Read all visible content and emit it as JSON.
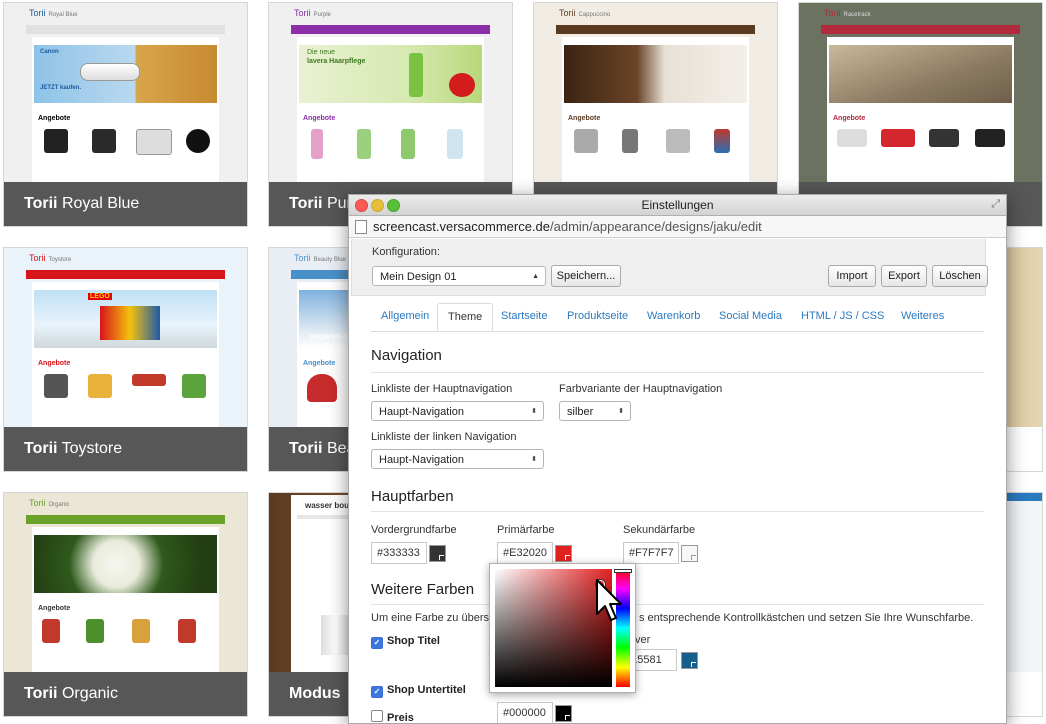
{
  "themes": [
    {
      "brand": "Torii",
      "name": "Royal Blue"
    },
    {
      "brand": "Torii",
      "name": "Purple"
    },
    {
      "brand": "Torii",
      "name": "Cappuccino"
    },
    {
      "brand": "Torii",
      "name": "Racetrack"
    },
    {
      "brand": "Torii",
      "name": "Toystore"
    },
    {
      "brand": "Torii",
      "name": "Beauty Blue"
    },
    {
      "brand": "Torii",
      "name": "Organic"
    },
    {
      "brand": "",
      "name": "Modus"
    }
  ],
  "thumbnails": {
    "offers_heading": "Angebote",
    "royal_banner_brand": "Canon",
    "royal_banner_cta": "JETZT kaufen.",
    "purple_banner_line1": "Die neue",
    "purple_banner_line2": "lavera Haarpflege",
    "lego_logo": "LEGO",
    "snow_banner": "SNOWWEAR",
    "modus_header": "wasser boutique"
  },
  "window": {
    "title": "Einstellungen",
    "url_domain": "screencast.versacommerce.de",
    "url_path": "/admin/appearance/designs/jaku/edit"
  },
  "config": {
    "label": "Konfiguration:",
    "selected_design": "Mein Design 01",
    "save": "Speichern...",
    "import": "Import",
    "export": "Export",
    "delete": "Löschen"
  },
  "tabs": [
    {
      "label": "Allgemein",
      "active": false
    },
    {
      "label": "Theme",
      "active": true
    },
    {
      "label": "Startseite",
      "active": false
    },
    {
      "label": "Produktseite",
      "active": false
    },
    {
      "label": "Warenkorb",
      "active": false
    },
    {
      "label": "Social Media",
      "active": false
    },
    {
      "label": "HTML / JS / CSS",
      "active": false
    },
    {
      "label": "Weiteres",
      "active": false
    }
  ],
  "navigation": {
    "heading": "Navigation",
    "main_nav_label": "Linkliste der Hauptnavigation",
    "main_nav_value": "Haupt-Navigation",
    "color_variant_label": "Farbvariante der Hauptnavigation",
    "color_variant_value": "silber",
    "left_nav_label": "Linkliste der linken Navigation",
    "left_nav_value": "Haupt-Navigation"
  },
  "main_colors": {
    "heading": "Hauptfarben",
    "foreground_label": "Vordergrundfarbe",
    "foreground_value": "#333333",
    "primary_label": "Primärfarbe",
    "primary_value": "#E32020",
    "secondary_label": "Sekundärfarbe",
    "secondary_value": "#F7F7F7"
  },
  "more_colors": {
    "heading": "Weitere Farben",
    "hint_start": "Um eine Farbe zu übersch",
    "hint_end": "s entsprechende Kontrollkästchen und setzen Sie Ihre Wunschfarbe.",
    "shop_title_label": "Shop Titel",
    "hover_label": "ver",
    "hover_value": "#15581",
    "shop_subtitle_label": "Shop Untertitel",
    "price_label": "Preis",
    "price_value": "#000000"
  },
  "colors": {
    "royal": "#1d5aa0",
    "purple": "#8b2ea8",
    "cappuccino": "#5b3a22",
    "racetrack": "#b22a3c",
    "toystore": "#d7141a",
    "beauty": "#4a90c8",
    "organic": "#6aa22a",
    "link": "#2a7abf",
    "primary": "#E32020"
  }
}
